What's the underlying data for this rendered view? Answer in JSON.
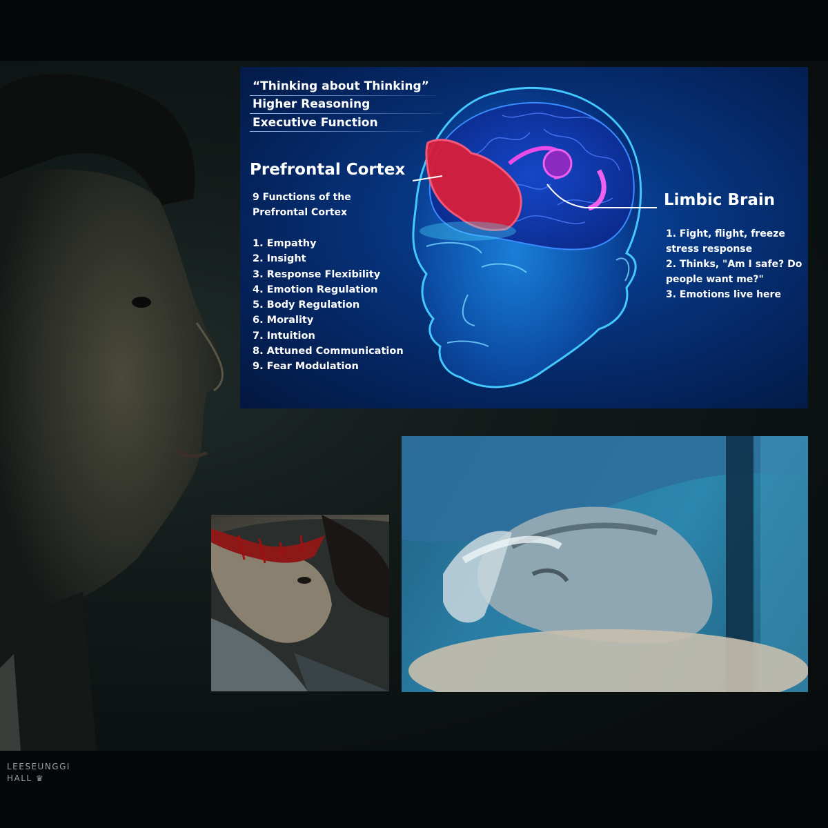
{
  "infographic": {
    "top_lines": [
      "“Thinking about Thinking”",
      "Higher Reasoning",
      "Executive Function"
    ],
    "prefrontal": {
      "title": "Prefrontal Cortex",
      "subtitle": "9 Functions of the Prefrontal Cortex",
      "functions": [
        "1. Empathy",
        "2. Insight",
        "3. Response Flexibility",
        "4. Emotion Regulation",
        "5. Body Regulation",
        "6. Morality",
        "7. Intuition",
        "8. Attuned Communication",
        "9. Fear Modulation"
      ]
    },
    "limbic": {
      "title": "Limbic Brain",
      "points": [
        "1. Fight, flight, freeze stress response",
        "2. Thinks, \"Am I safe? Do people want me?\"",
        "3. Emotions live here"
      ]
    }
  },
  "watermark": {
    "line1": "LEESEUNGGI",
    "line2": "HALL ♛"
  },
  "colors": {
    "background": "#050708",
    "infographic_blue": "#06357f",
    "prefrontal_red": "#e8243c",
    "limbic_pink": "#e040e8",
    "hospital_blue": "#2a7ea5"
  }
}
